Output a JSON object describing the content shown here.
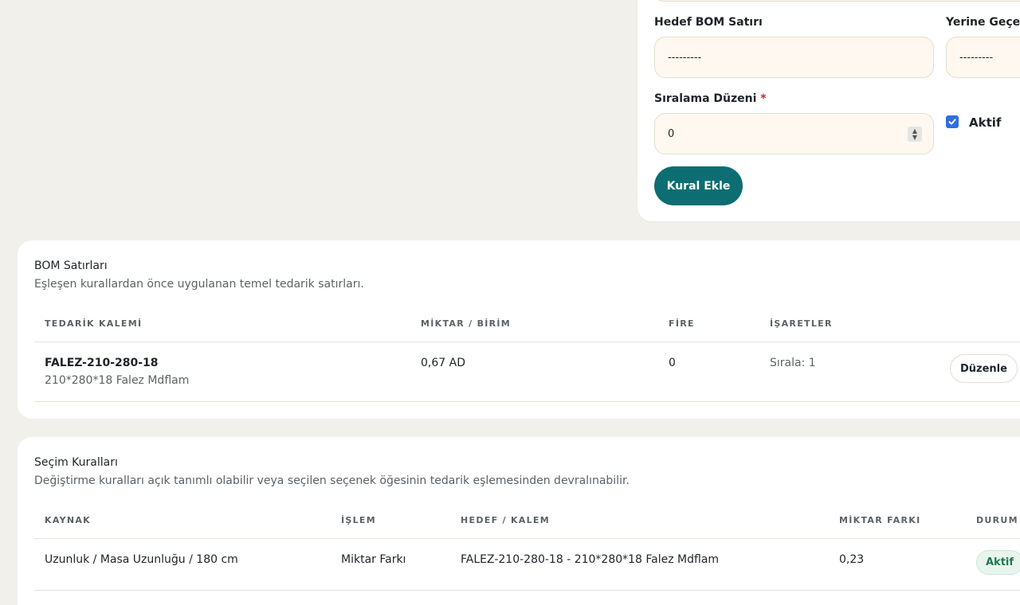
{
  "form": {
    "target_bom_line": {
      "label": "Hedef BOM Satırı",
      "value": "---------"
    },
    "replacement": {
      "label": "Yerine Geçecek",
      "value": "---------"
    },
    "sort_order": {
      "label": "Sıralama Düzeni",
      "required_mark": "*",
      "value": "0"
    },
    "active": {
      "label": "Aktif",
      "checked": true
    },
    "submit_label": "Kural Ekle"
  },
  "bom_lines": {
    "title": "BOM Satırları",
    "subtitle": "Eşleşen kurallardan önce uygulanan temel tedarik satırları.",
    "columns": [
      "TEDARİK KALEMİ",
      "MİKTAR / BİRİM",
      "FİRE",
      "İŞARETLER"
    ],
    "rows": [
      {
        "code": "FALEZ-210-280-18",
        "description": "210*280*18 Falez Mdflam",
        "qty_unit": "0,67 AD",
        "waste": "0",
        "flags": "Sırala: 1",
        "action_label": "Düzenle"
      }
    ]
  },
  "selection_rules": {
    "title": "Seçim Kuralları",
    "subtitle": "Değiştirme kuralları açık tanımlı olabilir veya seçilen seçenek öğesinin tedarik eşlemesinden devralınabilir.",
    "columns": [
      "KAYNAK",
      "İŞLEM",
      "HEDEF / KALEM",
      "MİKTAR FARKI",
      "DURUM"
    ],
    "rows": [
      {
        "source": "Uzunluk / Masa Uzunluğu / 180 cm",
        "operation": "Miktar Farkı",
        "target": "FALEZ-210-280-18 - 210*280*18 Falez Mdflam",
        "qty_diff": "0,23",
        "status": "Aktif"
      }
    ]
  },
  "colors": {
    "page_bg": "#f2f0eb",
    "card_bg": "#ffffff",
    "input_bg": "#fff8f0",
    "primary": "#0c6e72",
    "checkbox": "#2f6fde",
    "badge_bg": "#e8f5ee",
    "badge_text": "#1f7a4a",
    "required": "#c62828"
  }
}
